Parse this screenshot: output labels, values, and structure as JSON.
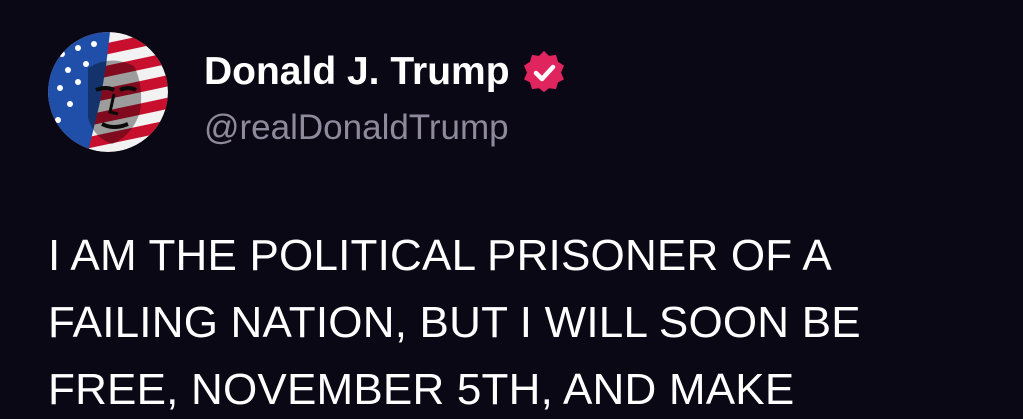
{
  "author": {
    "display_name": "Donald J. Trump",
    "handle": "@realDonaldTrump",
    "verified": true,
    "verified_badge_color": "#e0245e",
    "avatar_icon": "portrait-flag-avatar"
  },
  "post": {
    "lines": [
      "I AM THE POLITICAL PRISONER OF A",
      "FAILING NATION, BUT I WILL SOON BE",
      "FREE, NOVEMBER 5TH, AND MAKE"
    ]
  },
  "colors": {
    "background": "#0b0816",
    "text": "#ffffff",
    "handle": "#8e8a9c"
  }
}
